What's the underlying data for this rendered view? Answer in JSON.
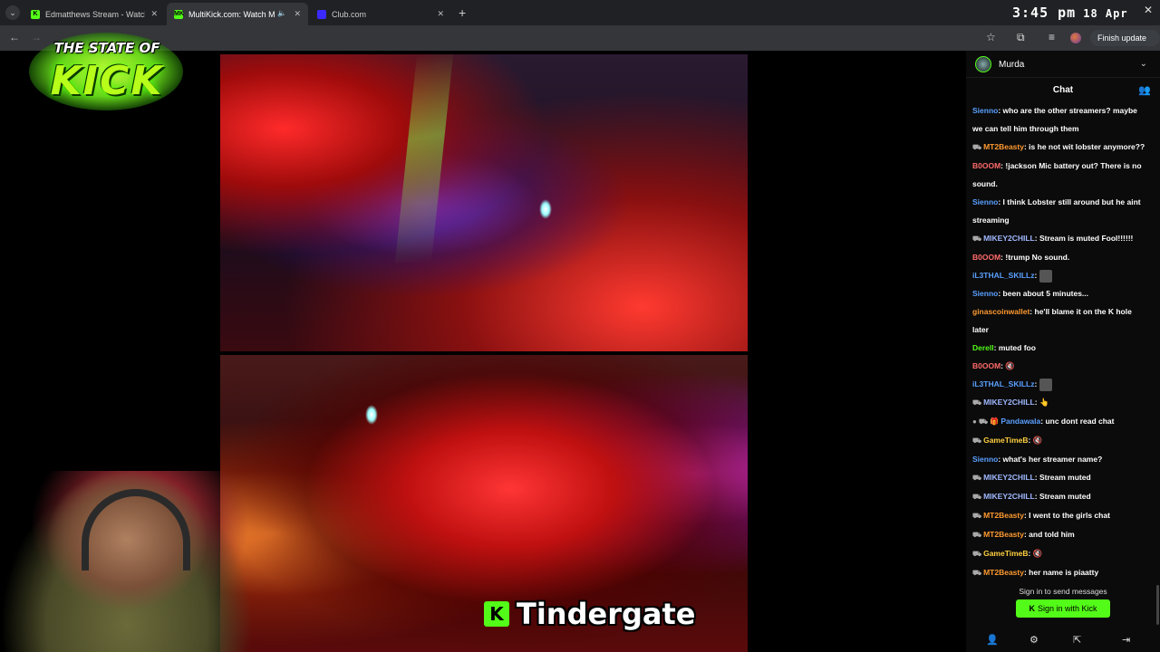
{
  "browser": {
    "tabs": [
      {
        "title": "Edmatthews Stream - Watch Live",
        "favicon_color": "#53fc18",
        "favicon_text": "K",
        "active": false
      },
      {
        "title": "MultiKick.com: Watch Multi",
        "favicon_color": "#53fc18",
        "favicon_text": "MK",
        "active": true
      },
      {
        "title": "Club.com",
        "favicon_color": "#3a2aff",
        "favicon_text": "",
        "active": false
      }
    ],
    "new_tab": "+",
    "update_button": "Finish update ⋮"
  },
  "clock": {
    "time": "3:45 pm",
    "date": "18 Apr 2026"
  },
  "logo": {
    "top_text": "THE STATE OF",
    "main_text": "KICK"
  },
  "caption": {
    "badge": "K",
    "text": "Tindergate"
  },
  "chat": {
    "username": "Murda",
    "title": "Chat",
    "messages": [
      {
        "badge": "",
        "name": "Sienno",
        "color": "#5aa0ff",
        "text": "who are the other streamers? maybe"
      },
      {
        "badge": "",
        "name": "",
        "color": "#fff",
        "text": "we can tell him through them"
      },
      {
        "badge": "⛟",
        "name": "MT2Beasty",
        "color": "#ff9a30",
        "text": "is he not wit lobster anymore??"
      },
      {
        "badge": "",
        "name": "B0OOM",
        "color": "#ff6a6a",
        "text": "!jackson Mic battery out? There is no"
      },
      {
        "badge": "",
        "name": "",
        "color": "#fff",
        "text": "sound."
      },
      {
        "badge": "",
        "name": "Sienno",
        "color": "#5aa0ff",
        "text": "I think Lobster still around but he aint"
      },
      {
        "badge": "",
        "name": "",
        "color": "#fff",
        "text": "streaming"
      },
      {
        "badge": "⛟",
        "name": "MIKEY2CHILL",
        "color": "#a0b8ff",
        "text": "Stream is muted Fool!!!!!!"
      },
      {
        "badge": "",
        "name": "B0OOM",
        "color": "#ff6a6a",
        "text": "!trump No sound."
      },
      {
        "badge": "",
        "name": "iL3THAL_SKILLz",
        "color": "#5aa0ff",
        "text": "",
        "emote": true
      },
      {
        "badge": "",
        "name": "Sienno",
        "color": "#5aa0ff",
        "text": "been about 5 minutes..."
      },
      {
        "badge": "",
        "name": "ginascoinwallet",
        "color": "#ff9a30",
        "text": "he'll blame it on the K hole"
      },
      {
        "badge": "",
        "name": "",
        "color": "#fff",
        "text": "later"
      },
      {
        "badge": "",
        "name": "Derell",
        "color": "#53fc18",
        "text": "muted foo"
      },
      {
        "badge": "",
        "name": "B0OOM",
        "color": "#ff6a6a",
        "text": "🔇"
      },
      {
        "badge": "",
        "name": "iL3THAL_SKILLz",
        "color": "#5aa0ff",
        "text": "",
        "emote": true
      },
      {
        "badge": "⛟",
        "name": "MIKEY2CHILL",
        "color": "#a0b8ff",
        "text": "👆"
      },
      {
        "badge": "● ⛟ 🎁",
        "name": "Pandawala",
        "color": "#5aa0ff",
        "text": "unc dont read chat"
      },
      {
        "badge": "⛟",
        "name": "GameTimeB",
        "color": "#ffd040",
        "text": "🔇"
      },
      {
        "badge": "",
        "name": "Sienno",
        "color": "#5aa0ff",
        "text": "what's her streamer name?"
      },
      {
        "badge": "⛟",
        "name": "MIKEY2CHILL",
        "color": "#a0b8ff",
        "text": "Stream muted"
      },
      {
        "badge": "⛟",
        "name": "MIKEY2CHILL",
        "color": "#a0b8ff",
        "text": "Stream muted"
      },
      {
        "badge": "⛟",
        "name": "MT2Beasty",
        "color": "#ff9a30",
        "text": "I went to the girls chat"
      },
      {
        "badge": "⛟",
        "name": "MT2Beasty",
        "color": "#ff9a30",
        "text": "and told him"
      },
      {
        "badge": "⛟",
        "name": "GameTimeB",
        "color": "#ffd040",
        "text": "🔇"
      },
      {
        "badge": "⛟",
        "name": "MT2Beasty",
        "color": "#ff9a30",
        "text": "her name is piaatty"
      }
    ],
    "sign_in_prompt": "Sign in to send messages",
    "sign_in_button": "Sign in with Kick",
    "sign_in_button_mark": "K"
  },
  "colors": {
    "kick_green": "#53fc18",
    "chat_bg": "#0b0b0b",
    "tab_bar": "#202124",
    "toolbar": "#35363a"
  }
}
